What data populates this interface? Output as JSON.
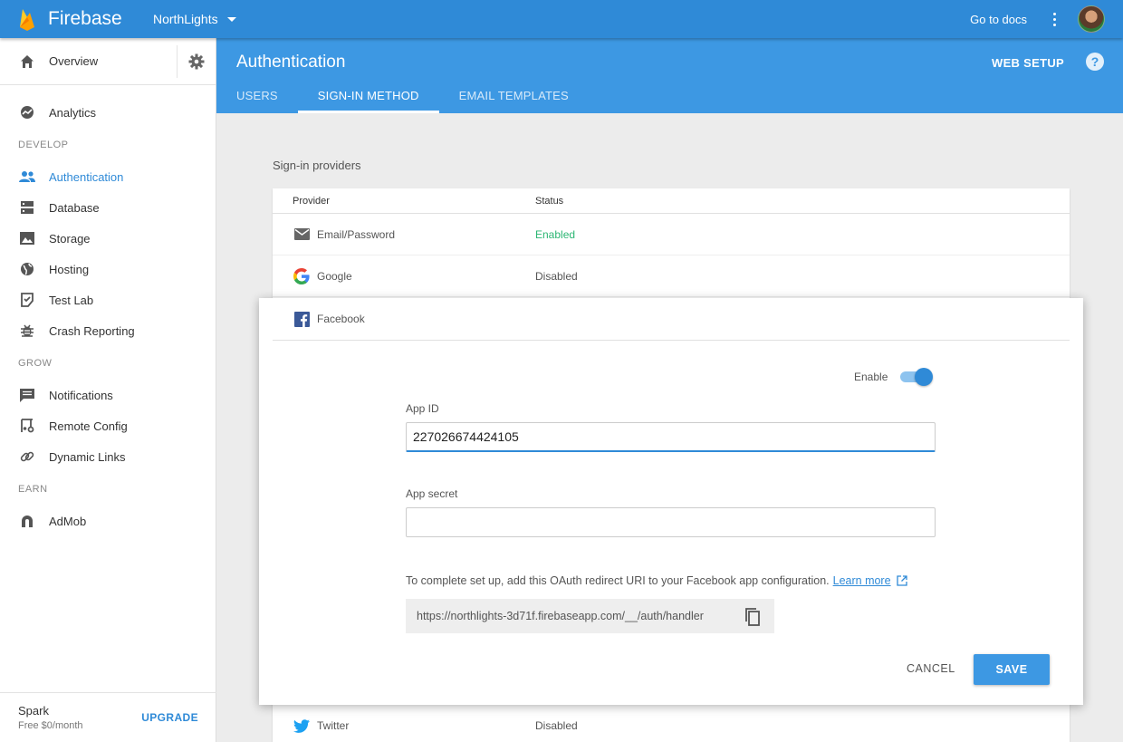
{
  "topbar": {
    "brand": "Firebase",
    "project": "NorthLights",
    "docs_link": "Go to docs"
  },
  "sidebar": {
    "overview": "Overview",
    "analytics": "Analytics",
    "sections": {
      "develop": "DEVELOP",
      "grow": "GROW",
      "earn": "EARN"
    },
    "develop_items": [
      {
        "label": "Authentication",
        "icon": "people-icon",
        "active": true
      },
      {
        "label": "Database",
        "icon": "database-icon"
      },
      {
        "label": "Storage",
        "icon": "image-icon"
      },
      {
        "label": "Hosting",
        "icon": "globe-icon"
      },
      {
        "label": "Test Lab",
        "icon": "checklist-icon"
      },
      {
        "label": "Crash Reporting",
        "icon": "bug-icon"
      }
    ],
    "grow_items": [
      {
        "label": "Notifications",
        "icon": "chat-icon"
      },
      {
        "label": "Remote Config",
        "icon": "remote-config-icon"
      },
      {
        "label": "Dynamic Links",
        "icon": "link-icon"
      }
    ],
    "earn_items": [
      {
        "label": "AdMob",
        "icon": "admob-icon"
      }
    ],
    "footer": {
      "plan": "Spark",
      "price": "Free $0/month",
      "upgrade": "UPGRADE"
    }
  },
  "header": {
    "title": "Authentication",
    "web_setup": "WEB SETUP",
    "help": "?",
    "tabs": [
      {
        "label": "USERS",
        "active": false
      },
      {
        "label": "SIGN-IN METHOD",
        "active": true
      },
      {
        "label": "EMAIL TEMPLATES",
        "active": false
      }
    ]
  },
  "providers": {
    "section_label": "Sign-in providers",
    "columns": {
      "provider": "Provider",
      "status": "Status"
    },
    "rows": [
      {
        "name": "Email/Password",
        "status": "Enabled",
        "icon": "email-icon"
      },
      {
        "name": "Google",
        "status": "Disabled",
        "icon": "google-icon"
      }
    ],
    "twitter": {
      "name": "Twitter",
      "status": "Disabled",
      "icon": "twitter-icon"
    }
  },
  "facebook_panel": {
    "name": "Facebook",
    "enable_label": "Enable",
    "enabled": true,
    "app_id_label": "App ID",
    "app_id_value": "227026674424105",
    "app_secret_label": "App secret",
    "app_secret_value": "",
    "note": "To complete set up, add this OAuth redirect URI to your Facebook app configuration.",
    "learn_more": "Learn more",
    "redirect_uri": "https://northlights-3d71f.firebaseapp.com/__/auth/handler",
    "cancel": "CANCEL",
    "save": "SAVE"
  },
  "colors": {
    "topbar": "#2f8ad7",
    "header": "#3d98e3",
    "accent": "#2f8ad7",
    "enabled_status": "#2bb673"
  }
}
